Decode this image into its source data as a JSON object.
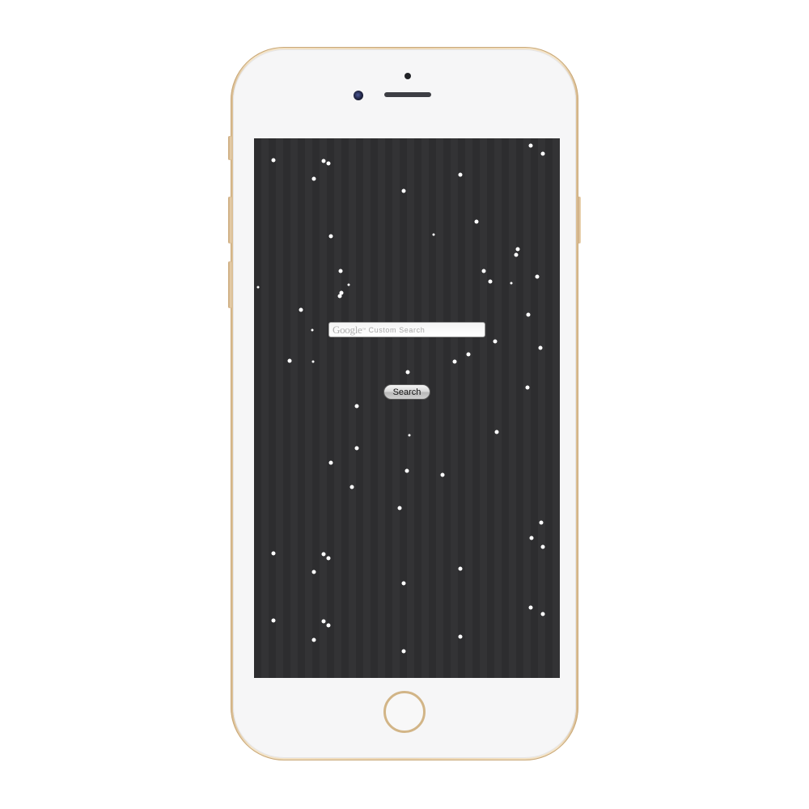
{
  "device": {
    "model": "iPhone",
    "frame_color": "#ecd6b3"
  },
  "search": {
    "logo_text": "Google",
    "logo_tm": "™",
    "placeholder": "Custom Search",
    "button_label": "Search"
  },
  "screen": {
    "background": "#2d2d2f",
    "star_color": "#ffffff"
  },
  "icons": [
    "camera-icon",
    "speaker-icon",
    "home-button-icon"
  ]
}
